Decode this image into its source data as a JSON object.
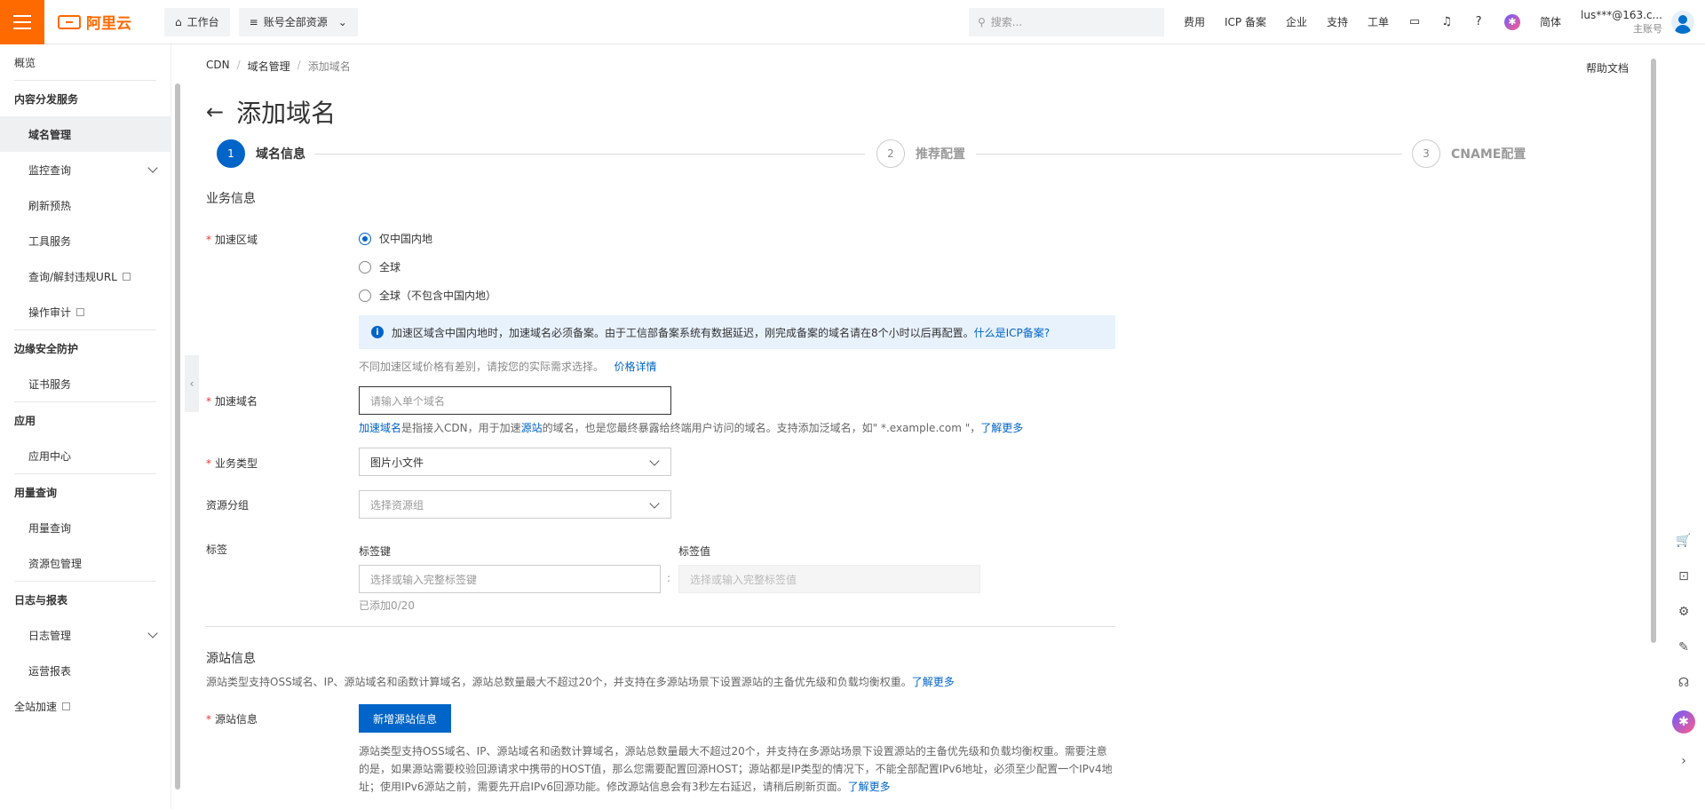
{
  "topbar": {
    "logo": "阿里云",
    "workbench": "工作台",
    "account_scope": "账号全部资源",
    "search_placeholder": "搜索...",
    "links": [
      "费用",
      "ICP 备案",
      "企业",
      "支持",
      "工单"
    ],
    "lang": "简体",
    "user_account": "lus***@163.c...",
    "user_role": "主账号"
  },
  "sidebar": {
    "overview": "概览",
    "group1": "内容分发服务",
    "domain_mgmt": "域名管理",
    "monitor": "监控查询",
    "refresh": "刷新预热",
    "tools": "工具服务",
    "query_url": "查询/解封违规URL",
    "audit": "操作审计",
    "group2": "边缘安全防护",
    "cert": "证书服务",
    "group3": "应用",
    "app_center": "应用中心",
    "group4": "用量查询",
    "usage": "用量查询",
    "package": "资源包管理",
    "group5": "日志与报表",
    "log_mgmt": "日志管理",
    "reports": "运营报表",
    "fullsite": "全站加速"
  },
  "breadcrumb": [
    "CDN",
    "域名管理",
    "添加域名"
  ],
  "help_doc": "帮助文档",
  "page_title": "添加域名",
  "steps": [
    {
      "num": "1",
      "label": "域名信息"
    },
    {
      "num": "2",
      "label": "推荐配置"
    },
    {
      "num": "3",
      "label": "CNAME配置"
    }
  ],
  "business": {
    "title": "业务信息",
    "region_label": "加速区域",
    "region_options": [
      "仅中国内地",
      "全球",
      "全球（不包含中国内地）"
    ],
    "notice_text": "加速区域含中国内地时，加速域名必须备案。由于工信部备案系统有数据延迟，刚完成备案的域名请在8个小时以后再配置。",
    "notice_link": "什么是ICP备案?",
    "price_hint": "不同加速区域价格有差别，请按您的实际需求选择。",
    "price_link": "价格详情",
    "domain_label": "加速域名",
    "domain_placeholder": "请输入单个域名",
    "domain_hint_link1": "加速域名",
    "domain_hint_mid1": "是指接入CDN，用于加速",
    "domain_hint_link2": "源站",
    "domain_hint_mid2": "的域名，也是您最终暴露给终端用户访问的域名。支持添加泛域名，如\" *.example.com \"，",
    "domain_hint_link3": "了解更多",
    "type_label": "业务类型",
    "type_value": "图片小文件",
    "group_label": "资源分组",
    "group_placeholder": "选择资源组",
    "tag_label": "标签",
    "tag_key_label": "标签键",
    "tag_value_label": "标签值",
    "tag_key_placeholder": "选择或输入完整标签键",
    "tag_value_placeholder": "选择或输入完整标签值",
    "tag_count": "已添加0/20"
  },
  "origin": {
    "title": "源站信息",
    "desc": "源站类型支持OSS域名、IP、源站域名和函数计算域名，源站总数量最大不超过20个，并支持在多源站场景下设置源站的主备优先级和负载均衡权重。",
    "desc_link": "了解更多",
    "label": "源站信息",
    "add_button": "新增源站信息",
    "para": "源站类型支持OSS域名、IP、源站域名和函数计算域名，源站总数量最大不超过20个，并支持在多源站场景下设置源站的主备优先级和负载均衡权重。需要注意的是，如果源站需要校验回源请求中携带的HOST值，那么您需要配置回源HOST；源站都是IP类型的情况下，不能全部配置IPv6地址，必须至少配置一个IPv4地址；使用IPv6源站之前，需要先开启IPv6回源功能。修改源站信息会有3秒左右延迟，请稍后刷新页面。",
    "para_link": "了解更多"
  },
  "colors": {
    "accent": "#0064c8",
    "brand": "#ff6a00"
  }
}
